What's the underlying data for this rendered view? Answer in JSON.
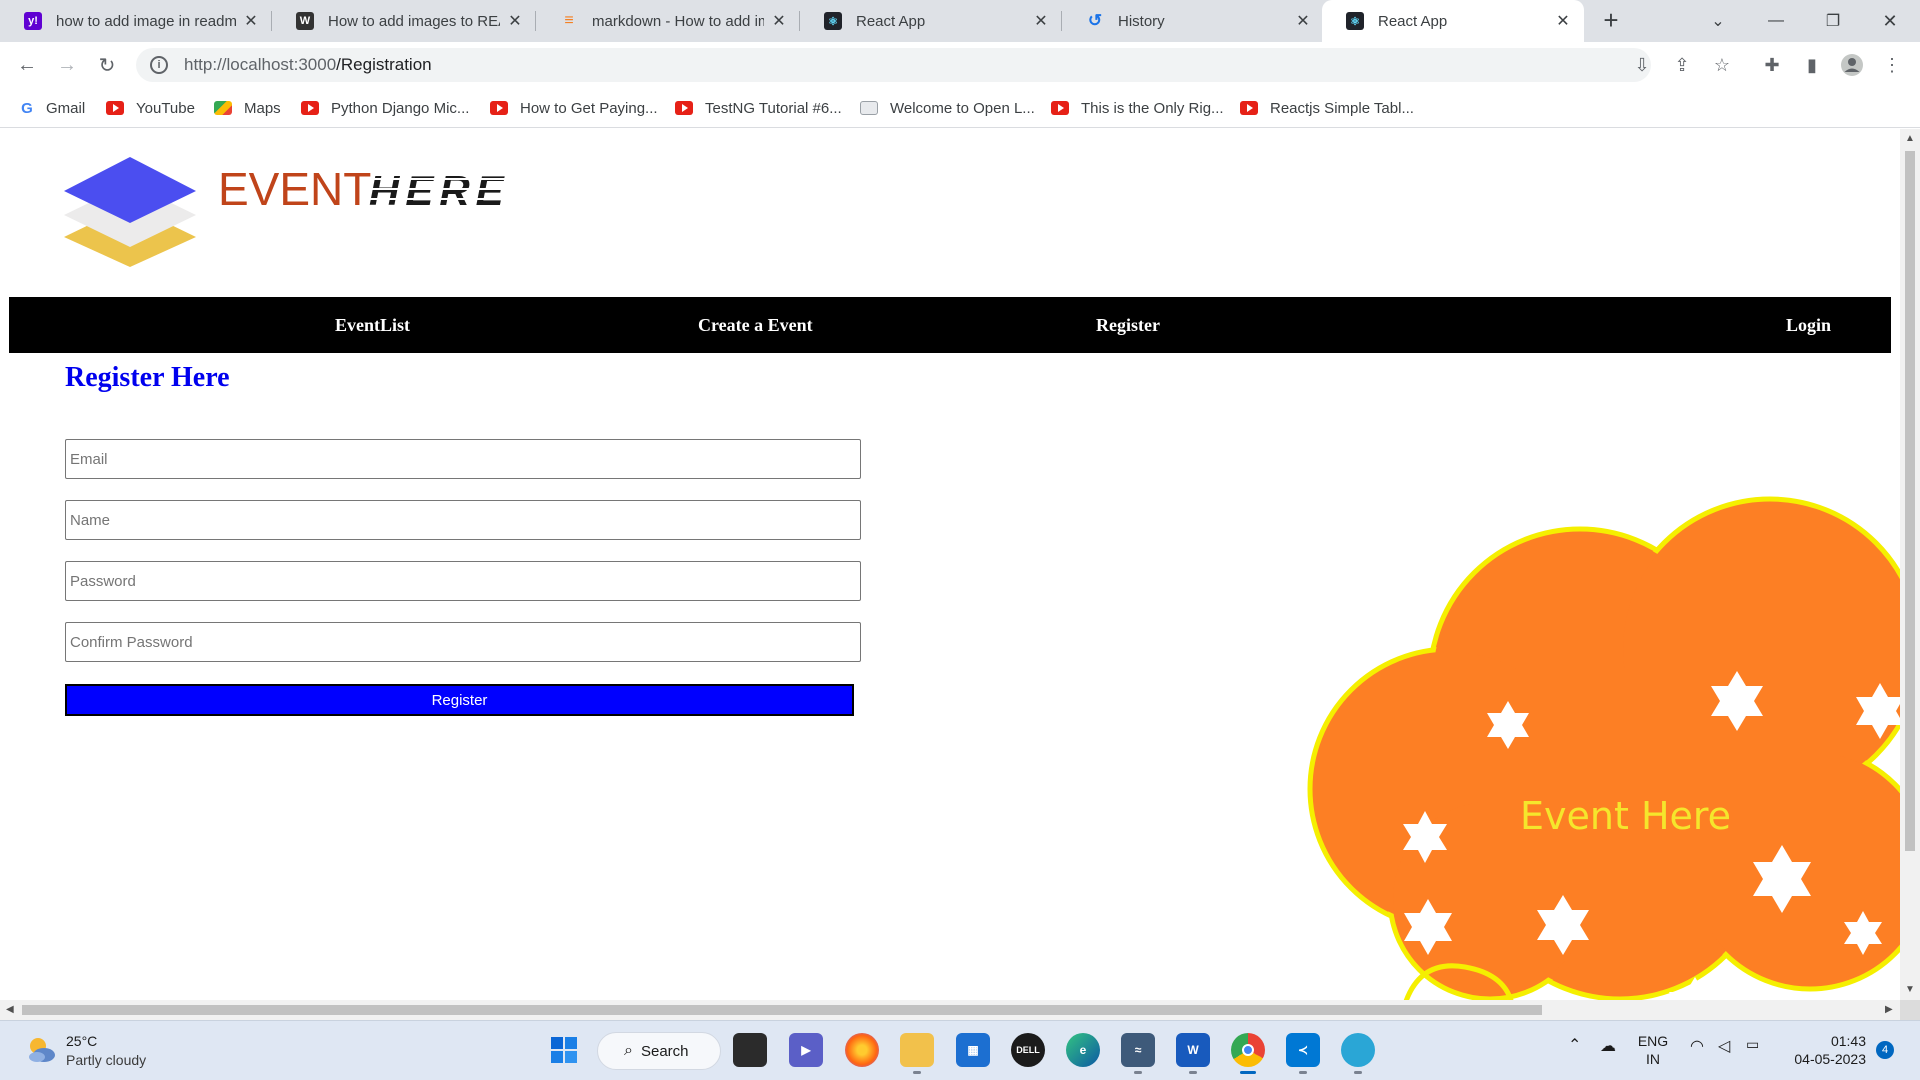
{
  "browser": {
    "tabs": [
      {
        "title": "how to add image in readm",
        "icon": "yahoo-icon",
        "color": "#6001d2"
      },
      {
        "title": "How to add images to REA",
        "icon": "wikihow-icon",
        "color": "#333333"
      },
      {
        "title": "markdown - How to add im",
        "icon": "stackoverflow-icon",
        "color": "#f48024"
      },
      {
        "title": "React App",
        "icon": "react-icon",
        "color": "#20232a"
      },
      {
        "title": "History",
        "icon": "history-icon",
        "color": "#1a73e8"
      },
      {
        "title": "React App",
        "icon": "react-icon",
        "color": "#20232a"
      }
    ],
    "active_tab_index": 5,
    "address": {
      "scheme_host": "http://localhost:3000",
      "path": "/Registration"
    },
    "bookmarks": [
      {
        "label": "Gmail",
        "icon": "google-icon"
      },
      {
        "label": "YouTube",
        "icon": "youtube-icon"
      },
      {
        "label": "Maps",
        "icon": "maps-icon"
      },
      {
        "label": "Python Django Mic...",
        "icon": "youtube-icon"
      },
      {
        "label": "How to Get Paying...",
        "icon": "youtube-icon"
      },
      {
        "label": "TestNG Tutorial #6...",
        "icon": "youtube-icon"
      },
      {
        "label": "Welcome to Open L...",
        "icon": "page-icon"
      },
      {
        "label": "This is the Only Rig...",
        "icon": "youtube-icon"
      },
      {
        "label": "Reactjs Simple Tabl...",
        "icon": "youtube-icon"
      }
    ]
  },
  "app": {
    "logo": {
      "word1": "EVENT",
      "word2": "HERE"
    },
    "nav": {
      "event_list": "EventList",
      "create_event": "Create a Event",
      "register": "Register",
      "login": "Login"
    },
    "form": {
      "title": "Register Here",
      "email_placeholder": "Email",
      "name_placeholder": "Name",
      "password_placeholder": "Password",
      "confirm_placeholder": "Confirm Password",
      "submit_label": "Register"
    },
    "banner_text": "Event Here",
    "colors": {
      "nav_bg": "#000000",
      "title": "#0000ee",
      "button": "#0000ff",
      "cloud": "#fd7f24",
      "cloud_border": "#f5ef00",
      "banner_text": "#f5e62c",
      "logo_text": "#c0441a"
    }
  },
  "taskbar": {
    "weather": {
      "temp": "25°C",
      "condition": "Partly cloudy"
    },
    "search_label": "Search",
    "language": {
      "line1": "ENG",
      "line2": "IN"
    },
    "clock": {
      "time": "01:43",
      "date": "04-05-2023"
    },
    "notification_count": "4"
  }
}
